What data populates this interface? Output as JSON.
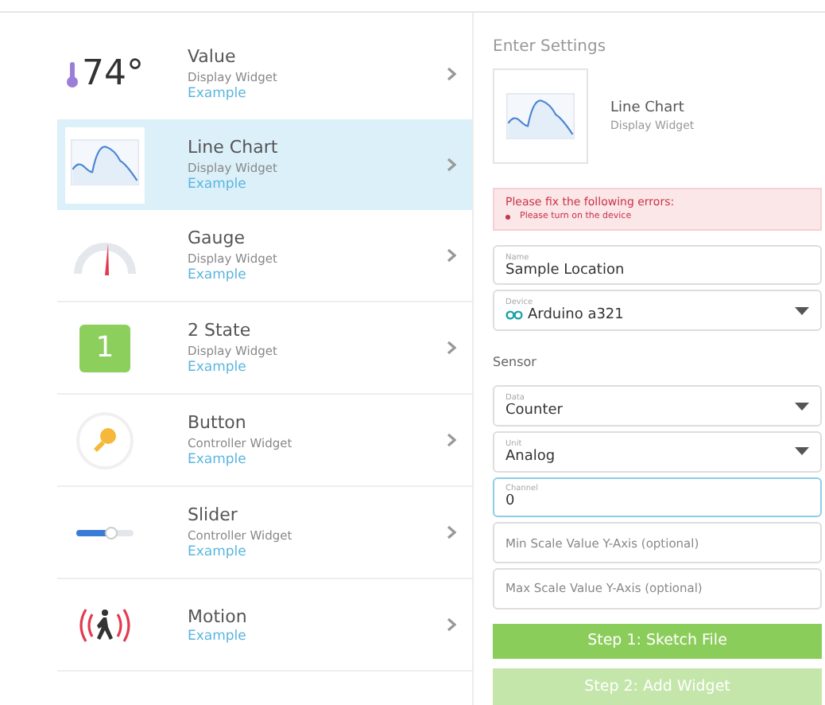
{
  "widgets": [
    {
      "kind": "value",
      "icon_text": "74°",
      "title": "Value",
      "subtitle": "Display Widget",
      "link": "Example",
      "selected": false
    },
    {
      "kind": "linechart",
      "title": "Line Chart",
      "subtitle": "Display Widget",
      "link": "Example",
      "selected": true
    },
    {
      "kind": "gauge",
      "title": "Gauge",
      "subtitle": "Display Widget",
      "link": "Example",
      "selected": false
    },
    {
      "kind": "twostate",
      "icon_text": "1",
      "title": "2 State",
      "subtitle": "Display Widget",
      "link": "Example",
      "selected": false
    },
    {
      "kind": "button",
      "title": "Button",
      "subtitle": "Controller Widget",
      "link": "Example",
      "selected": false
    },
    {
      "kind": "slider",
      "title": "Slider",
      "subtitle": "Controller Widget",
      "link": "Example",
      "selected": false
    },
    {
      "kind": "motion",
      "title": "Motion",
      "link": "Example",
      "selected": false
    }
  ],
  "settings": {
    "heading": "Enter Settings",
    "preview": {
      "title": "Line Chart",
      "subtitle": "Display Widget"
    },
    "error": {
      "title": "Please fix the following errors:",
      "items": [
        "Please turn on the device"
      ]
    },
    "fields": [
      {
        "kind": "input",
        "label": "Name",
        "value": "Sample Location",
        "focused": false
      },
      {
        "kind": "select",
        "label": "Device",
        "value": "Arduino a321",
        "device_icon": true,
        "focused": false
      },
      {
        "kind": "section",
        "text": "Sensor"
      },
      {
        "kind": "select",
        "label": "Data",
        "value": "Counter",
        "focused": false
      },
      {
        "kind": "select",
        "label": "Unit",
        "value": "Analog",
        "focused": false
      },
      {
        "kind": "input",
        "label": "Channel",
        "value": "0",
        "focused": true
      },
      {
        "kind": "input",
        "placeholder": "Min Scale Value Y-Axis (optional)",
        "focused": false
      },
      {
        "kind": "input",
        "placeholder": "Max Scale Value Y-Axis (optional)",
        "focused": false
      }
    ],
    "buttons": [
      {
        "label": "Step 1: Sketch File",
        "disabled": false
      },
      {
        "label": "Step 2: Add Widget",
        "disabled": true
      }
    ]
  }
}
